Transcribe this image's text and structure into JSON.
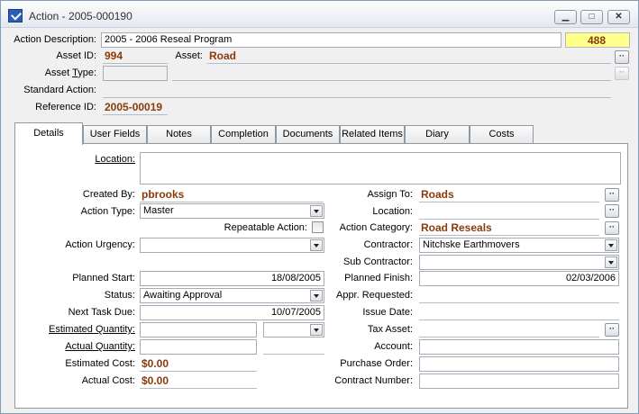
{
  "window": {
    "title": "Action - 2005-000190",
    "controls": {
      "minimize": "▁",
      "maximize": "□",
      "close": "✕"
    }
  },
  "header": {
    "action_description_label": "Action Description:",
    "action_description_value": "2005 - 2006 Reseal Program",
    "number_badge": "488",
    "asset_id_label": "Asset ID:",
    "asset_id_value": "994",
    "asset_label": "Asset:",
    "asset_value": "Road",
    "asset_type_label_pre": "Asset ",
    "asset_type_label_u": "T",
    "asset_type_label_post": "ype:",
    "standard_action_label": "Standard Action:",
    "reference_id_label": "Reference ID:",
    "reference_id_value": "2005-00019",
    "ellipsis": "··"
  },
  "tabs": [
    {
      "label": "Details"
    },
    {
      "label": "User Fields"
    },
    {
      "label": "Notes"
    },
    {
      "label": "Completion"
    },
    {
      "label": "Documents"
    },
    {
      "label": "Related Items"
    },
    {
      "label": "Diary"
    },
    {
      "label": "Costs"
    }
  ],
  "details": {
    "location_label": "Location:",
    "created_by_label": "Created By:",
    "created_by_value": "pbrooks",
    "action_type_label": "Action Type:",
    "action_type_value": "Master",
    "repeatable_action_label": "Repeatable Action:",
    "action_urgency_label": "Action Urgency:",
    "planned_start_label": "Planned Start:",
    "planned_start_value": "18/08/2005",
    "status_label": "Status:",
    "status_value": "Awaiting Approval",
    "next_task_due_label": "Next Task Due:",
    "next_task_due_value": "10/07/2005",
    "estimated_quantity_label": "Estimated Quantity:",
    "actual_quantity_label": "Actual Quantity:",
    "estimated_cost_label": "Estimated Cost:",
    "estimated_cost_value": "$0.00",
    "actual_cost_label": "Actual Cost:",
    "actual_cost_value": "$0.00",
    "assign_to_label": "Assign To:",
    "assign_to_value": "Roads",
    "location2_label": "Location:",
    "action_category_label": "Action Category:",
    "action_category_value": "Road Reseals",
    "contractor_label": "Contractor:",
    "contractor_value": "Nitchske Earthmovers",
    "sub_contractor_label": "Sub Contractor:",
    "planned_finish_label": "Planned Finish:",
    "planned_finish_value": "02/03/2006",
    "appr_requested_label": "Appr. Requested:",
    "issue_date_label": "Issue Date:",
    "tax_asset_label": "Tax Asset:",
    "account_label": "Account:",
    "purchase_order_label": "Purchase Order:",
    "contract_number_label": "Contract Number:"
  }
}
